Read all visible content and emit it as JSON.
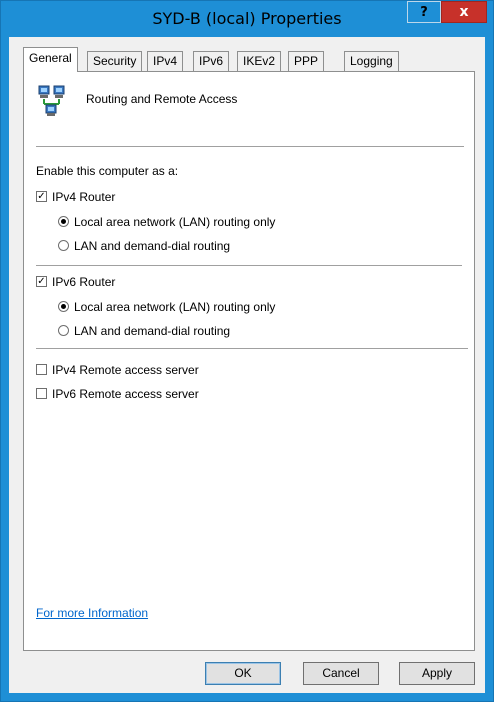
{
  "window": {
    "title": "SYD-B (local) Properties",
    "help_glyph": "?",
    "close_glyph": "x"
  },
  "tabs": [
    {
      "label": "General",
      "active": true
    },
    {
      "label": "Security"
    },
    {
      "label": "IPv4"
    },
    {
      "label": "IPv6"
    },
    {
      "label": "IKEv2"
    },
    {
      "label": "PPP"
    },
    {
      "label": "Logging"
    }
  ],
  "general": {
    "header_label": "Routing and Remote Access",
    "icon": "computers-network-icon",
    "enable_label": "Enable this computer as a:",
    "ipv4_router": {
      "label": "IPv4 Router",
      "checked": true,
      "options": [
        {
          "label": "Local area network (LAN) routing only",
          "selected": true
        },
        {
          "label": "LAN and demand-dial routing",
          "selected": false
        }
      ]
    },
    "ipv6_router": {
      "label": "IPv6 Router",
      "checked": true,
      "options": [
        {
          "label": "Local area network (LAN) routing only",
          "selected": true
        },
        {
          "label": "LAN and demand-dial routing",
          "selected": false
        }
      ]
    },
    "ipv4_ras": {
      "label": "IPv4 Remote access server",
      "checked": false
    },
    "ipv6_ras": {
      "label": "IPv6 Remote access server",
      "checked": false
    },
    "more_info": "For more Information"
  },
  "buttons": {
    "ok": "OK",
    "cancel": "Cancel",
    "apply": "Apply"
  },
  "colors": {
    "titlebar": "#1e8fd6",
    "close_button": "#c7312a",
    "link": "#0066cc"
  }
}
